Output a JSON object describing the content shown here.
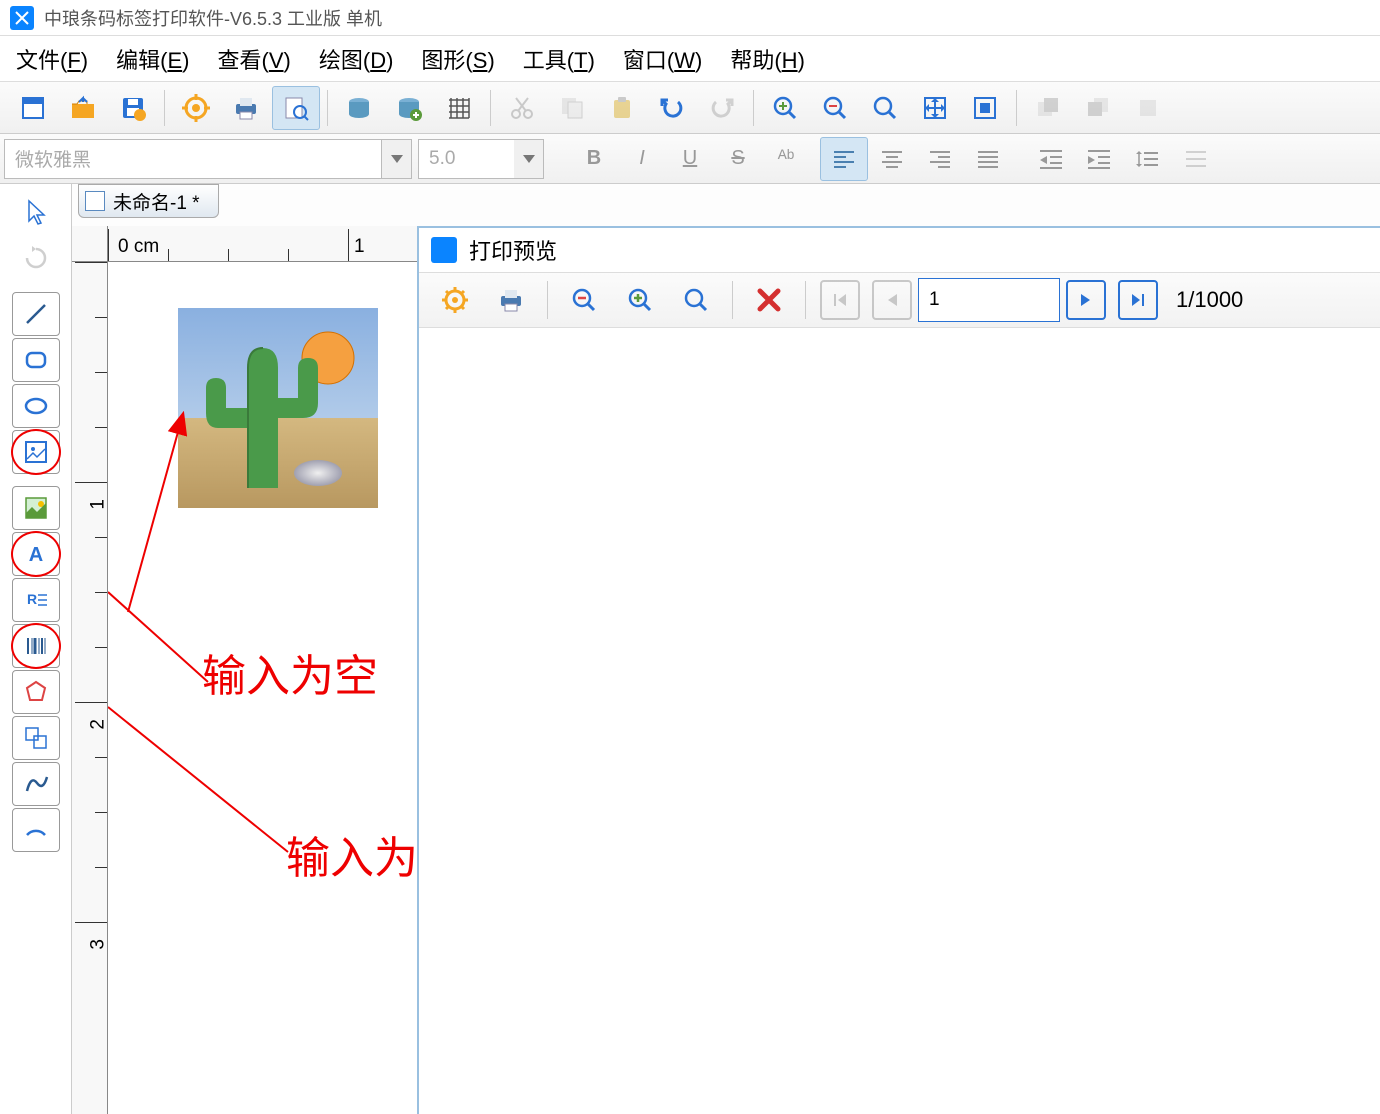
{
  "title": "中琅条码标签打印软件-V6.5.3 工业版 单机",
  "menus": {
    "file": {
      "text": "文件",
      "key": "F"
    },
    "edit": {
      "text": "编辑",
      "key": "E"
    },
    "view": {
      "text": "查看",
      "key": "V"
    },
    "draw": {
      "text": "绘图",
      "key": "D"
    },
    "shape": {
      "text": "图形",
      "key": "S"
    },
    "tool": {
      "text": "工具",
      "key": "T"
    },
    "window": {
      "text": "窗口",
      "key": "W"
    },
    "help": {
      "text": "帮助",
      "key": "H"
    }
  },
  "font": {
    "name_placeholder": "微软雅黑",
    "size_placeholder": "5.0"
  },
  "doc_tab": "未命名-1 *",
  "ruler": {
    "unit_label": "0 cm",
    "majors": [
      "1",
      "2",
      "3"
    ],
    "h_major": "1"
  },
  "preview": {
    "title": "打印预览",
    "page_input": "1",
    "page_total": "1/1000"
  },
  "annotations": {
    "text1": "输入为空",
    "text2": "输入为"
  },
  "side_tools": [
    {
      "name": "pointer-tool-icon",
      "circle": false
    },
    {
      "name": "rotate-tool-icon",
      "circle": false
    },
    {
      "name": "line-tool-icon",
      "circle": false
    },
    {
      "name": "rounded-rect-tool-icon",
      "circle": false
    },
    {
      "name": "ellipse-tool-icon",
      "circle": false
    },
    {
      "name": "image-placeholder-tool-icon",
      "circle": true
    },
    {
      "name": "image-tool-icon",
      "circle": false
    },
    {
      "name": "text-tool-icon",
      "circle": true
    },
    {
      "name": "richtext-tool-icon",
      "circle": false
    },
    {
      "name": "barcode-tool-icon",
      "circle": true
    },
    {
      "name": "polygon-tool-icon",
      "circle": false
    },
    {
      "name": "group-tool-icon",
      "circle": false
    },
    {
      "name": "curve-tool-icon",
      "circle": false
    },
    {
      "name": "arc-tool-icon",
      "circle": false
    }
  ]
}
